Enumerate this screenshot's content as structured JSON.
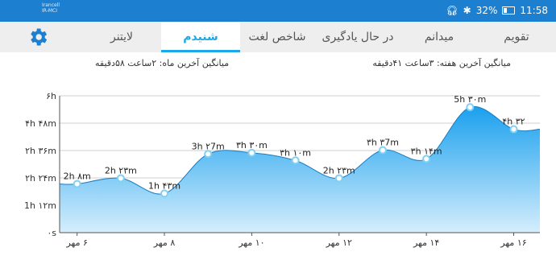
{
  "status_bar": {
    "carrier_line1": "Irancell",
    "carrier_line2": "IR-MCI",
    "battery": "32%",
    "time": "11:58"
  },
  "tabs": [
    {
      "label": "تقویم",
      "active": false
    },
    {
      "label": "میدانم",
      "active": false
    },
    {
      "label": "در حال یادگیری",
      "active": false
    },
    {
      "label": "شاخص لغت",
      "active": false
    },
    {
      "label": "شنیدم",
      "active": true
    },
    {
      "label": "لایتنر",
      "active": false
    }
  ],
  "settings_icon": "gear-icon",
  "stats": {
    "week_avg": "میانگین آخرین هفته: ۳ساعت ۴۱دقیقه",
    "month_avg": "میانگین آخرین ماه: ۲ساعت ۵۸دقیقه"
  },
  "colors": {
    "accent": "#1ca8e8",
    "status_bar": "#1d7fcf",
    "area_top": "#1aa0ee",
    "area_bottom": "#d5eefc"
  },
  "chart_data": {
    "type": "area",
    "y_tick_labels": [
      "۰s",
      "1h ۱۲m",
      "۲h ۲۴m",
      "۲h ۳۶m",
      "۴h ۴۸m",
      "۶h"
    ],
    "y_ticks": [
      0,
      72,
      144,
      216,
      288,
      360
    ],
    "ylim": [
      0,
      360
    ],
    "x_tick_labels": [
      "۶ مهر",
      "۸ مهر",
      "۱۰ مهر",
      "۱۲ مهر",
      "۱۴ مهر",
      "۱۶ مهر"
    ],
    "x_ticks": [
      6,
      8,
      10,
      12,
      14,
      16
    ],
    "xlim": [
      5.6,
      16.6
    ],
    "points": [
      {
        "x": 6,
        "y": 128,
        "label": "2h ۸m"
      },
      {
        "x": 7,
        "y": 143,
        "label": "2h ۲۳m"
      },
      {
        "x": 8,
        "y": 103,
        "label": "1h ۴۳m"
      },
      {
        "x": 9,
        "y": 207,
        "label": "3h ۲7m"
      },
      {
        "x": 10,
        "y": 210,
        "label": "۳h ۳۰m"
      },
      {
        "x": 11,
        "y": 190,
        "label": "۳h ۱۰m"
      },
      {
        "x": 12,
        "y": 143,
        "label": "2h ۲۳m"
      },
      {
        "x": 13,
        "y": 217,
        "label": "۳h ۳7m"
      },
      {
        "x": 14,
        "y": 194,
        "label": "۳h ۱۴m"
      },
      {
        "x": 15,
        "y": 330,
        "label": "5h ۳۰m"
      },
      {
        "x": 16,
        "y": 272,
        "label": "۴h ۳۲"
      }
    ],
    "grid": true
  }
}
